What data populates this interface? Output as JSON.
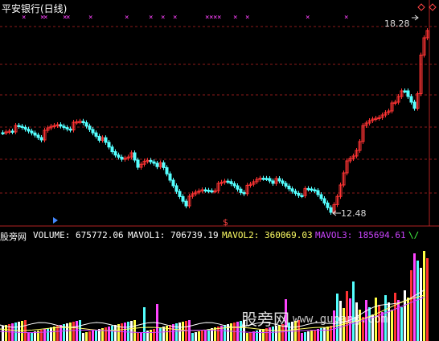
{
  "header": {
    "stock_title": "平安银行(日线)"
  },
  "price_chart": {
    "high_label": "18.28",
    "low_label": "12.48",
    "marker_label": "$"
  },
  "volume_panel": {
    "name": "股旁网",
    "volume": "VOLUME: 675772.06",
    "mavol1": "MAVOL1: 706739.19",
    "mavol2": "MAVOL2: 360069.03",
    "mavol3": "MAVOL3: 185694.61",
    "corner": "\\/"
  },
  "watermark": {
    "text_cn": "股旁网",
    "text_en": "www.gupang.com"
  },
  "colors": {
    "up": "#ff3333",
    "down": "#54ffff",
    "grid": "#8b1a1a",
    "marker_x": "#ff44ff",
    "vol_yellow": "#ffff44",
    "vol_magenta": "#ff44ff",
    "mavol3": "#cc44ff",
    "mavol2": "#ffff66"
  }
}
